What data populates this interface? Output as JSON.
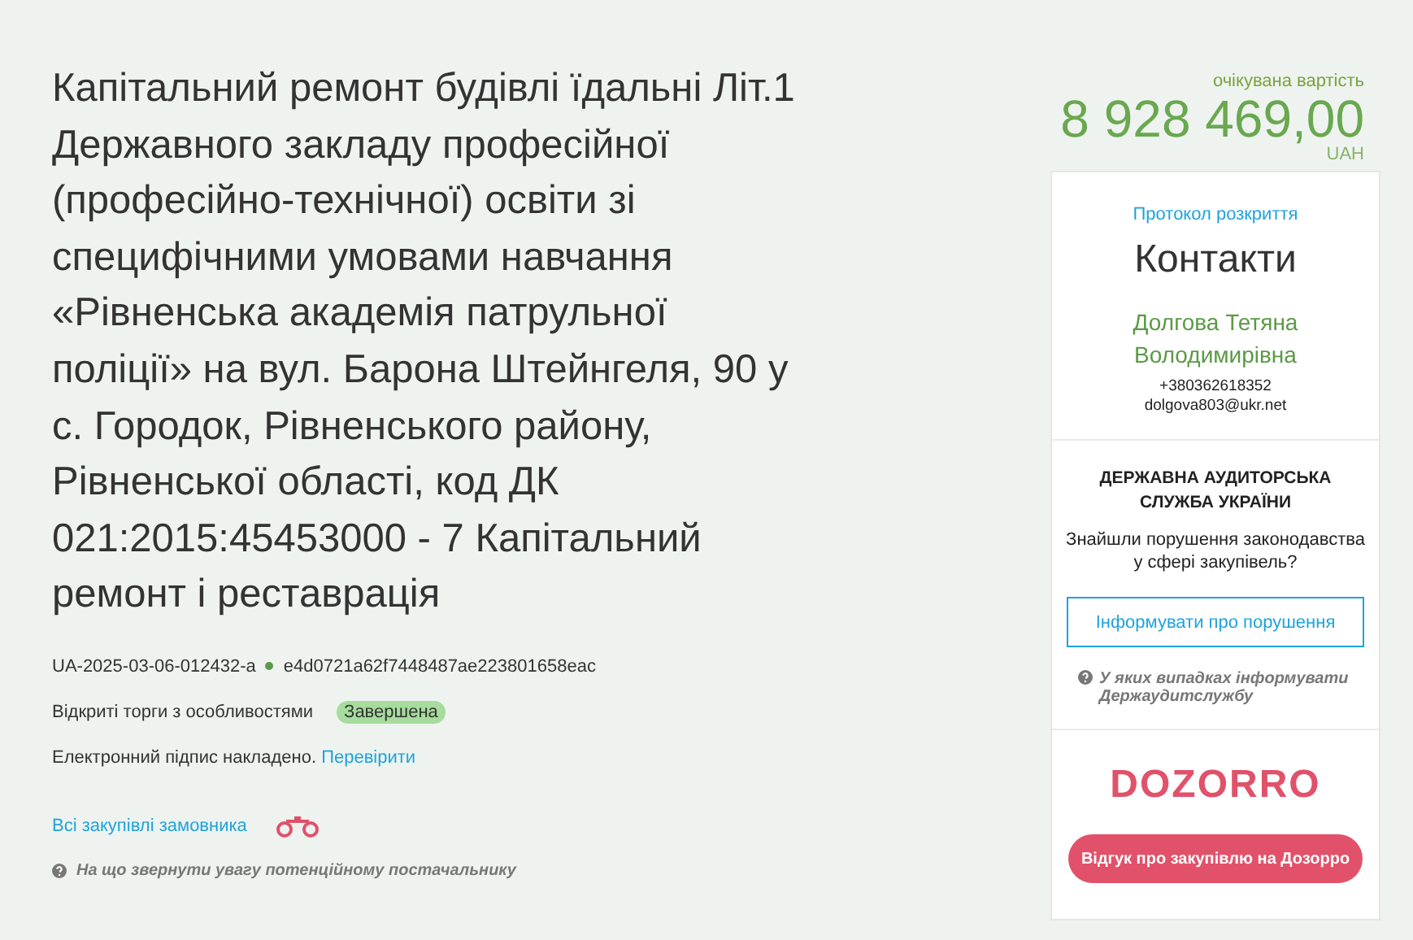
{
  "title": "Капітальний ремонт будівлі їдальні Літ.1 Державного закладу професійної (професійно-технічної) освіти зі специфічними умовами навчання «Рівненська академія патрульної поліції» на вул. Барона Штейнгеля, 90 у с. Городок, Рівненського району, Рівненської області, код ДК 021:2015:45453000 - 7 Капітальний ремонт і реставрація",
  "tender_id": "UA-2025-03-06-012432-a",
  "hash": "e4d0721a62f7448487ae223801658eac",
  "procedure": "Відкриті торги з особливостями",
  "status": {
    "label": "Завершена",
    "color": "#a6dc9c"
  },
  "signature": {
    "text": "Електронний підпис накладено.",
    "link": "Перевірити"
  },
  "customer_link": "Всі закупівлі замовника",
  "hint": "На що звернути увагу потенційному постачальнику",
  "price": {
    "label": "очікувана вартість",
    "amount": "8 928 469,00",
    "currency": "UAH"
  },
  "contacts": {
    "protocol_link": "Протокол розкриття",
    "heading": "Контакти",
    "name": "Долгова Тетяна Володимирівна",
    "phone": "+380362618352",
    "email": "dolgova803@ukr.net"
  },
  "audit": {
    "heading": "ДЕРЖАВНА АУДИТОРСЬКА СЛУЖБА УКРАЇНИ",
    "question": "Знайшли порушення законодавства у сфері закупівель?",
    "button": "Інформувати про порушення",
    "hint": "У яких випадках інформувати Держаудитслужбу"
  },
  "dozorro": {
    "logo": "DOZORRO",
    "button": "Відгук про закупівлю на Дозорро"
  }
}
